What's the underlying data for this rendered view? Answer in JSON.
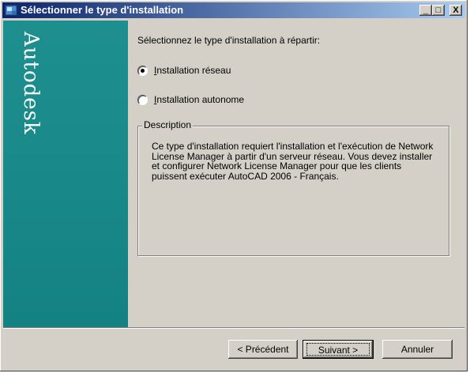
{
  "window": {
    "title": "Sélectionner le type d'installation",
    "controls": {
      "minimize": "_",
      "maximize": "□",
      "close": "X"
    }
  },
  "sidebar": {
    "brand": "Autodesk"
  },
  "content": {
    "prompt": "Sélectionnez le type d'installation à répartir:",
    "options": [
      {
        "label": "Installation réseau",
        "checked": true
      },
      {
        "label": "Installation autonome",
        "checked": false
      }
    ],
    "description": {
      "title": "Description",
      "text": "Ce type d'installation requiert l'installation et l'exécution de Network License Manager à partir d'un serveur réseau. Vous devez installer et configurer Network License Manager pour que les clients puissent exécuter AutoCAD 2006 - Français."
    }
  },
  "buttons": {
    "previous": "< Précédent",
    "next": "Suivant >",
    "cancel": "Annuler"
  },
  "colors": {
    "sidebar": "#148282",
    "titlebar": "#0a246a",
    "face": "#d4d0c8"
  }
}
